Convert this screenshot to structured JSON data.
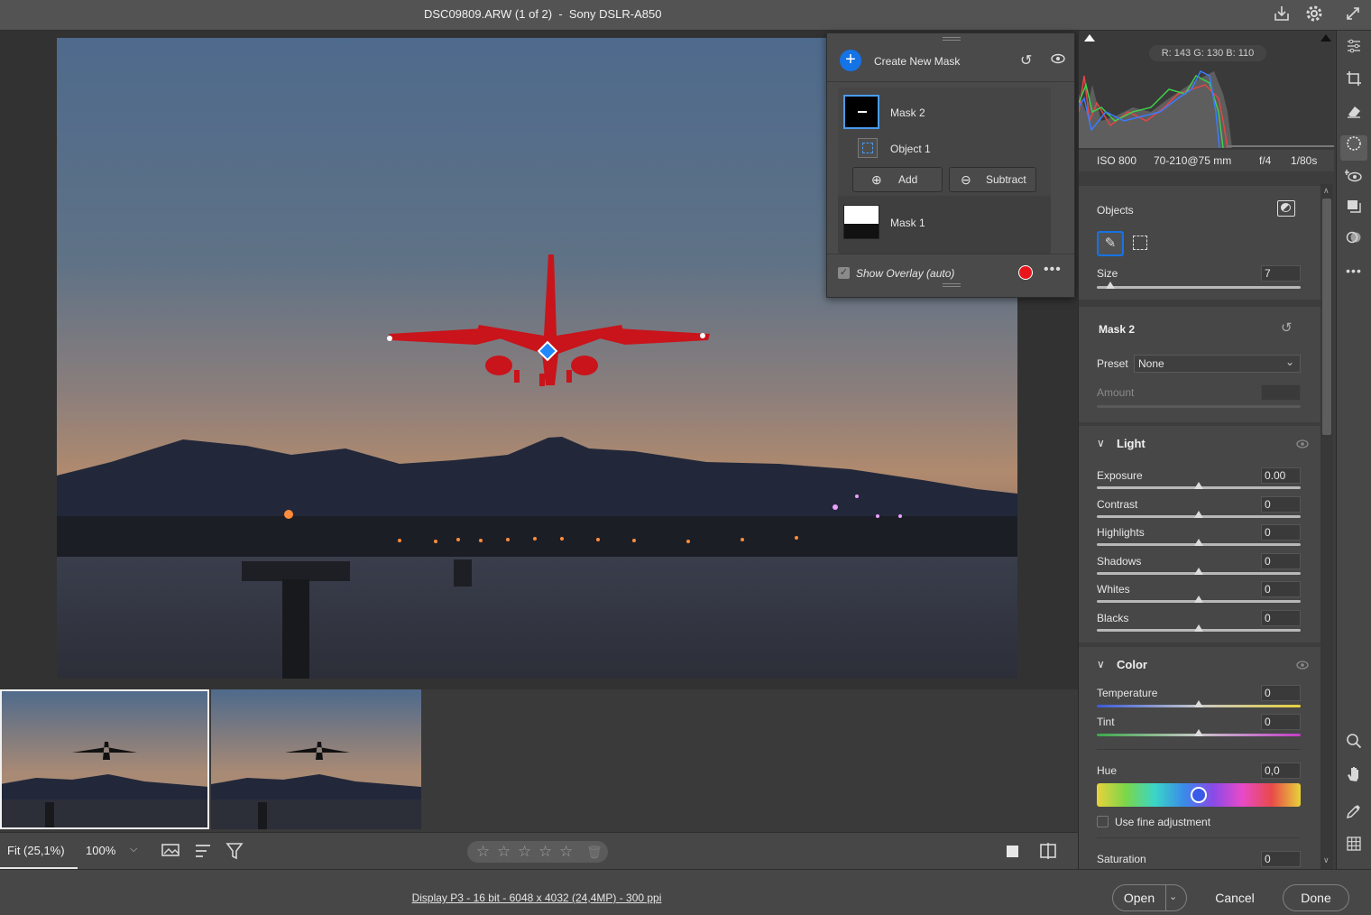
{
  "window": {
    "title": "DSC09809.ARW (1 of 2)  -  Sony DSLR-A850",
    "icons": [
      "save-icon",
      "gear-icon",
      "expand-icon"
    ]
  },
  "mask_panel": {
    "create_label": "Create New Mask",
    "masks": [
      {
        "name": "Mask 2",
        "components": [
          "Object 1"
        ]
      },
      {
        "name": "Mask 1",
        "components": []
      }
    ],
    "add_label": "Add",
    "subtract_label": "Subtract",
    "overlay_label": "Show Overlay (auto)",
    "overlay_checked": true,
    "overlay_color": "#e8161b"
  },
  "histogram": {
    "readout": "R: 143   G: 130   B: 110"
  },
  "exif": {
    "iso": "ISO 800",
    "lens": "70-210@75 mm",
    "aperture": "f/4",
    "shutter": "1/80s"
  },
  "objects_section": {
    "title": "Objects",
    "size_label": "Size",
    "size_value": "7",
    "size_fraction": 0.06
  },
  "mask_section": {
    "title": "Mask 2",
    "preset_label": "Preset",
    "preset_value": "None",
    "amount_label": "Amount"
  },
  "light_section": {
    "title": "Light",
    "sliders": [
      {
        "label": "Exposure",
        "value": "0.00"
      },
      {
        "label": "Contrast",
        "value": "0"
      },
      {
        "label": "Highlights",
        "value": "0"
      },
      {
        "label": "Shadows",
        "value": "0"
      },
      {
        "label": "Whites",
        "value": "0"
      },
      {
        "label": "Blacks",
        "value": "0"
      }
    ]
  },
  "color_section": {
    "title": "Color",
    "temperature_label": "Temperature",
    "temperature_value": "0",
    "tint_label": "Tint",
    "tint_value": "0",
    "hue_label": "Hue",
    "hue_value": "0,0",
    "fine_adjust_label": "Use fine adjustment",
    "saturation_label": "Saturation",
    "saturation_value": "0"
  },
  "bottom_toolbar": {
    "zoom_fit": "Fit (25,1%)",
    "zoom_100": "100%",
    "stars": 5
  },
  "status": {
    "info": "Display P3 - 16 bit - 6048 x 4032 (24,4MP) - 300 ppi",
    "open_label": "Open",
    "cancel_label": "Cancel",
    "done_label": "Done"
  },
  "tools": [
    "edit-sliders-icon",
    "crop-icon",
    "eraser-icon",
    "masking-icon",
    "redeye-icon",
    "layers-icon",
    "presets-icon",
    "more-icon",
    "zoom-icon",
    "hand-icon",
    "eyedropper-icon",
    "grid-icon"
  ],
  "accent_color": "#1473e6"
}
